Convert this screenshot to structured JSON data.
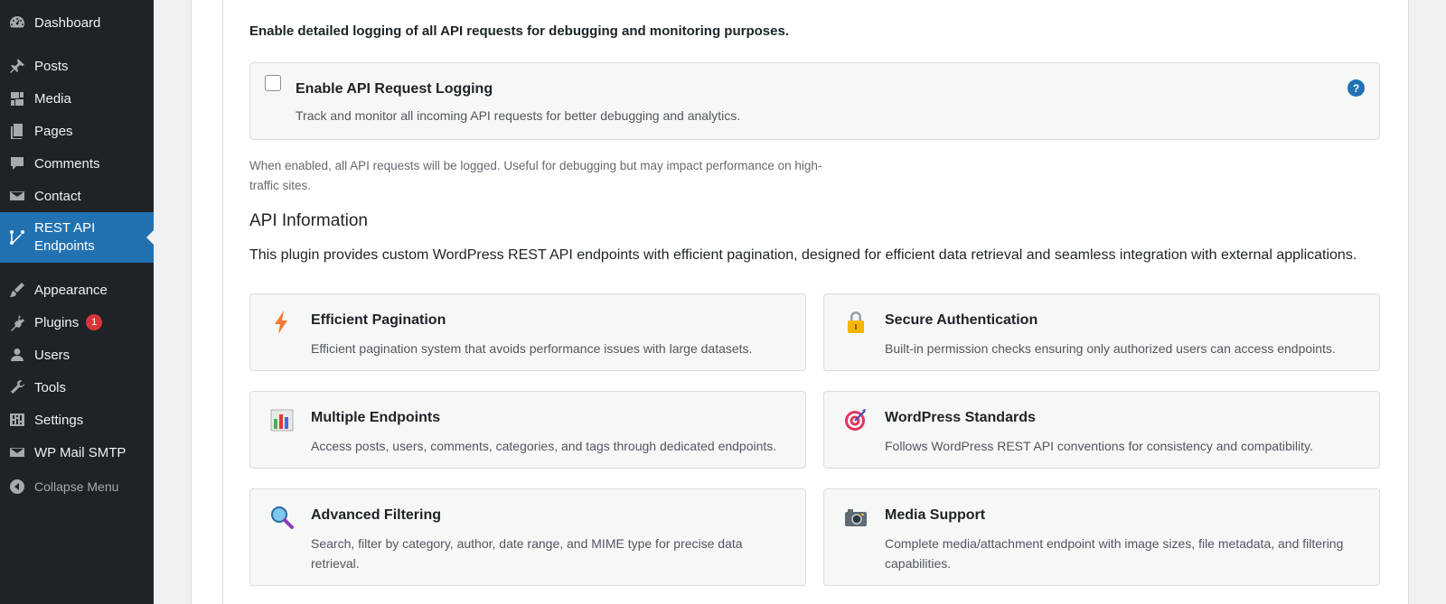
{
  "sidebar": {
    "items": [
      {
        "label": "Dashboard",
        "icon": "dashboard-icon"
      },
      {
        "label": "Posts",
        "icon": "pin-icon"
      },
      {
        "label": "Media",
        "icon": "media-icon"
      },
      {
        "label": "Pages",
        "icon": "pages-icon"
      },
      {
        "label": "Comments",
        "icon": "comment-icon"
      },
      {
        "label": "Contact",
        "icon": "mail-icon"
      },
      {
        "label": "REST API Endpoints",
        "icon": "api-icon"
      },
      {
        "label": "Appearance",
        "icon": "brush-icon"
      },
      {
        "label": "Plugins",
        "icon": "plug-icon",
        "badge": "1"
      },
      {
        "label": "Users",
        "icon": "user-icon"
      },
      {
        "label": "Tools",
        "icon": "wrench-icon"
      },
      {
        "label": "Settings",
        "icon": "sliders-icon"
      },
      {
        "label": "WP Mail SMTP",
        "icon": "mail-icon"
      }
    ],
    "collapse_label": "Collapse Menu"
  },
  "logging": {
    "description": "Enable detailed logging of all API requests for debugging and monitoring purposes.",
    "option_title": "Enable API Request Logging",
    "option_desc": "Track and monitor all incoming API requests for better debugging and analytics.",
    "help": "?",
    "note": "When enabled, all API requests will be logged. Useful for debugging but may impact performance on high-traffic sites."
  },
  "api_info": {
    "title": "API Information",
    "intro": "This plugin provides custom WordPress REST API endpoints with efficient pagination, designed for efficient data retrieval and seamless integration with external applications.",
    "cards": [
      {
        "title": "Efficient Pagination",
        "desc": "Efficient pagination system that avoids performance issues with large datasets.",
        "icon": "lightning-icon"
      },
      {
        "title": "Secure Authentication",
        "desc": "Built-in permission checks ensuring only authorized users can access endpoints.",
        "icon": "lock-icon"
      },
      {
        "title": "Multiple Endpoints",
        "desc": "Access posts, users, comments, categories, and tags through dedicated endpoints.",
        "icon": "bar-chart-icon"
      },
      {
        "title": "WordPress Standards",
        "desc": "Follows WordPress REST API conventions for consistency and compatibility.",
        "icon": "target-icon"
      },
      {
        "title": "Advanced Filtering",
        "desc": "Search, filter by category, author, date range, and MIME type for precise data retrieval.",
        "icon": "magnifier-icon"
      },
      {
        "title": "Media Support",
        "desc": "Complete media/attachment endpoint with image sizes, file metadata, and filtering capabilities.",
        "icon": "camera-icon"
      }
    ]
  }
}
